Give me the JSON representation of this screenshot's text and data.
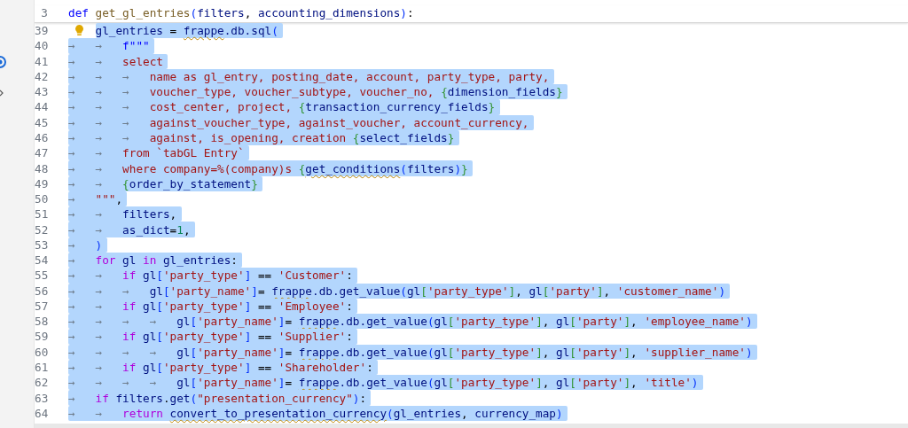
{
  "sticky_line": {
    "number": "3",
    "tokens": [
      {
        "kind": "kw",
        "text": "def "
      },
      {
        "kind": "fn",
        "text": "get_gl_entries"
      },
      {
        "kind": "pa",
        "text": "("
      },
      {
        "kind": "id",
        "text": "filters"
      },
      {
        "kind": "op",
        "text": ", "
      },
      {
        "kind": "id",
        "text": "accounting_dimensions"
      },
      {
        "kind": "pa",
        "text": ")"
      },
      {
        "kind": "op",
        "text": ":"
      }
    ]
  },
  "lines": [
    {
      "number": "39",
      "lightbulb": true,
      "selected": true,
      "tokens": [
        {
          "kind": "id",
          "text": "gl_entries"
        },
        {
          "kind": "op",
          "text": " = "
        },
        {
          "kind": "warn",
          "text": "frappe"
        },
        {
          "kind": "id",
          "text": ".db.sql"
        },
        {
          "kind": "pa",
          "text": "("
        }
      ]
    },
    {
      "number": "40",
      "indent": "→   →",
      "selected": true,
      "tokens": [
        {
          "kind": "kw",
          "text": "f\"\"\""
        }
      ]
    },
    {
      "number": "41",
      "indent": "→   →",
      "selected": true,
      "tokens": [
        {
          "kind": "str",
          "text": "select"
        }
      ]
    },
    {
      "number": "42",
      "indent": "→   →   →",
      "selected": true,
      "tokens": [
        {
          "kind": "str",
          "text": "name as gl_entry, posting_date, account, party_type, party,"
        }
      ]
    },
    {
      "number": "43",
      "indent": "→   →   →",
      "selected": true,
      "tokens": [
        {
          "kind": "str",
          "text": "voucher_type, voucher_subtype, voucher_no, "
        },
        {
          "kind": "br",
          "text": "{"
        },
        {
          "kind": "id",
          "text": "dimension_fields"
        },
        {
          "kind": "br",
          "text": "}"
        }
      ]
    },
    {
      "number": "44",
      "indent": "→   →   →",
      "selected": true,
      "tokens": [
        {
          "kind": "str",
          "text": "cost_center, project, "
        },
        {
          "kind": "br",
          "text": "{"
        },
        {
          "kind": "id",
          "text": "transaction_currency_fields"
        },
        {
          "kind": "br",
          "text": "}"
        }
      ]
    },
    {
      "number": "45",
      "indent": "→   →   →",
      "selected": true,
      "tokens": [
        {
          "kind": "str",
          "text": "against_voucher_type, against_voucher, account_currency,"
        }
      ]
    },
    {
      "number": "46",
      "indent": "→   →   →",
      "selected": true,
      "tokens": [
        {
          "kind": "str",
          "text": "against, is_opening, creation "
        },
        {
          "kind": "br",
          "text": "{"
        },
        {
          "kind": "id",
          "text": "select_fields"
        },
        {
          "kind": "br",
          "text": "}"
        }
      ]
    },
    {
      "number": "47",
      "indent": "→   →",
      "selected": true,
      "tokens": [
        {
          "kind": "str",
          "text": "from `tabGL Entry`"
        }
      ]
    },
    {
      "number": "48",
      "indent": "→   →",
      "selected": true,
      "tokens": [
        {
          "kind": "str",
          "text": "where company=%(company)s "
        },
        {
          "kind": "br",
          "text": "{"
        },
        {
          "kind": "warn",
          "text": "get_conditions"
        },
        {
          "kind": "pa",
          "text": "("
        },
        {
          "kind": "id",
          "text": "filters"
        },
        {
          "kind": "pa",
          "text": ")"
        },
        {
          "kind": "br",
          "text": "}"
        }
      ]
    },
    {
      "number": "49",
      "indent": "→   →",
      "selected": true,
      "tokens": [
        {
          "kind": "br",
          "text": "{"
        },
        {
          "kind": "id",
          "text": "order_by_statement"
        },
        {
          "kind": "br",
          "text": "}"
        }
      ]
    },
    {
      "number": "50",
      "indent": "→",
      "selected": true,
      "tokens": [
        {
          "kind": "str",
          "text": "\"\"\""
        },
        {
          "kind": "op",
          "text": ","
        }
      ]
    },
    {
      "number": "51",
      "indent": "→   →",
      "selected": true,
      "tokens": [
        {
          "kind": "id",
          "text": "filters"
        },
        {
          "kind": "op",
          "text": ","
        }
      ]
    },
    {
      "number": "52",
      "indent": "→   →",
      "selected": true,
      "tokens": [
        {
          "kind": "id",
          "text": "as_dict"
        },
        {
          "kind": "op",
          "text": "="
        },
        {
          "kind": "num",
          "text": "1"
        },
        {
          "kind": "op",
          "text": ","
        }
      ]
    },
    {
      "number": "53",
      "indent": "→",
      "selected": true,
      "tokens": [
        {
          "kind": "pa",
          "text": ")"
        }
      ]
    },
    {
      "number": "54",
      "indent": "→",
      "selected": true,
      "tokens": [
        {
          "kind": "ctl",
          "text": "for "
        },
        {
          "kind": "id",
          "text": "gl "
        },
        {
          "kind": "ctl",
          "text": "in "
        },
        {
          "kind": "id",
          "text": "gl_entries"
        },
        {
          "kind": "op",
          "text": ":"
        }
      ]
    },
    {
      "number": "55",
      "indent": "→   →",
      "selected": true,
      "tokens": [
        {
          "kind": "ctl",
          "text": "if "
        },
        {
          "kind": "id",
          "text": "gl"
        },
        {
          "kind": "pa",
          "text": "["
        },
        {
          "kind": "str",
          "text": "'party_type'"
        },
        {
          "kind": "pa",
          "text": "]"
        },
        {
          "kind": "op",
          "text": " == "
        },
        {
          "kind": "str",
          "text": "'Customer'"
        },
        {
          "kind": "op",
          "text": ":"
        }
      ]
    },
    {
      "number": "56",
      "indent": "→   →   →",
      "selected": true,
      "tokens": [
        {
          "kind": "id",
          "text": "gl"
        },
        {
          "kind": "pa",
          "text": "["
        },
        {
          "kind": "str",
          "text": "'party_name'"
        },
        {
          "kind": "pa",
          "text": "]"
        },
        {
          "kind": "op",
          "text": "= "
        },
        {
          "kind": "warn",
          "text": "frappe"
        },
        {
          "kind": "id",
          "text": ".db.get_value"
        },
        {
          "kind": "pa",
          "text": "("
        },
        {
          "kind": "id",
          "text": "gl"
        },
        {
          "kind": "br",
          "text": "["
        },
        {
          "kind": "str",
          "text": "'party_type'"
        },
        {
          "kind": "br",
          "text": "]"
        },
        {
          "kind": "op",
          "text": ", "
        },
        {
          "kind": "id",
          "text": "gl"
        },
        {
          "kind": "br",
          "text": "["
        },
        {
          "kind": "str",
          "text": "'party'"
        },
        {
          "kind": "br",
          "text": "]"
        },
        {
          "kind": "op",
          "text": ", "
        },
        {
          "kind": "str",
          "text": "'customer_name'"
        },
        {
          "kind": "pa",
          "text": ")"
        }
      ]
    },
    {
      "number": "57",
      "indent": "→   →",
      "selected": true,
      "tokens": [
        {
          "kind": "ctl",
          "text": "if "
        },
        {
          "kind": "id",
          "text": "gl"
        },
        {
          "kind": "pa",
          "text": "["
        },
        {
          "kind": "str",
          "text": "'party_type'"
        },
        {
          "kind": "pa",
          "text": "]"
        },
        {
          "kind": "op",
          "text": " == "
        },
        {
          "kind": "str",
          "text": "'Employee'"
        },
        {
          "kind": "op",
          "text": ":"
        }
      ]
    },
    {
      "number": "58",
      "indent": "→   →   →   →",
      "selected": true,
      "tokens": [
        {
          "kind": "id",
          "text": "gl"
        },
        {
          "kind": "pa",
          "text": "["
        },
        {
          "kind": "str",
          "text": "'party_name'"
        },
        {
          "kind": "pa",
          "text": "]"
        },
        {
          "kind": "op",
          "text": "= "
        },
        {
          "kind": "warn",
          "text": "frappe"
        },
        {
          "kind": "id",
          "text": ".db.get_value"
        },
        {
          "kind": "pa",
          "text": "("
        },
        {
          "kind": "id",
          "text": "gl"
        },
        {
          "kind": "br",
          "text": "["
        },
        {
          "kind": "str",
          "text": "'party_type'"
        },
        {
          "kind": "br",
          "text": "]"
        },
        {
          "kind": "op",
          "text": ", "
        },
        {
          "kind": "id",
          "text": "gl"
        },
        {
          "kind": "br",
          "text": "["
        },
        {
          "kind": "str",
          "text": "'party'"
        },
        {
          "kind": "br",
          "text": "]"
        },
        {
          "kind": "op",
          "text": ", "
        },
        {
          "kind": "str",
          "text": "'employee_name'"
        },
        {
          "kind": "pa",
          "text": ")"
        }
      ]
    },
    {
      "number": "59",
      "indent": "→   →",
      "selected": true,
      "tokens": [
        {
          "kind": "ctl",
          "text": "if "
        },
        {
          "kind": "id",
          "text": "gl"
        },
        {
          "kind": "pa",
          "text": "["
        },
        {
          "kind": "str",
          "text": "'party_type'"
        },
        {
          "kind": "pa",
          "text": "]"
        },
        {
          "kind": "op",
          "text": " == "
        },
        {
          "kind": "str",
          "text": "'Supplier'"
        },
        {
          "kind": "op",
          "text": ":"
        }
      ]
    },
    {
      "number": "60",
      "indent": "→   →   →   →",
      "selected": true,
      "tokens": [
        {
          "kind": "id",
          "text": "gl"
        },
        {
          "kind": "pa",
          "text": "["
        },
        {
          "kind": "str",
          "text": "'party_name'"
        },
        {
          "kind": "pa",
          "text": "]"
        },
        {
          "kind": "op",
          "text": "= "
        },
        {
          "kind": "warn",
          "text": "frappe"
        },
        {
          "kind": "id",
          "text": ".db.get_value"
        },
        {
          "kind": "pa",
          "text": "("
        },
        {
          "kind": "id",
          "text": "gl"
        },
        {
          "kind": "br",
          "text": "["
        },
        {
          "kind": "str",
          "text": "'party_type'"
        },
        {
          "kind": "br",
          "text": "]"
        },
        {
          "kind": "op",
          "text": ", "
        },
        {
          "kind": "id",
          "text": "gl"
        },
        {
          "kind": "br",
          "text": "["
        },
        {
          "kind": "str",
          "text": "'party'"
        },
        {
          "kind": "br",
          "text": "]"
        },
        {
          "kind": "op",
          "text": ", "
        },
        {
          "kind": "str",
          "text": "'supplier_name'"
        },
        {
          "kind": "pa",
          "text": ")"
        }
      ]
    },
    {
      "number": "61",
      "indent": "→   →",
      "selected": true,
      "tokens": [
        {
          "kind": "ctl",
          "text": "if "
        },
        {
          "kind": "id",
          "text": "gl"
        },
        {
          "kind": "pa",
          "text": "["
        },
        {
          "kind": "str",
          "text": "'party_type'"
        },
        {
          "kind": "pa",
          "text": "]"
        },
        {
          "kind": "op",
          "text": " == "
        },
        {
          "kind": "str",
          "text": "'Shareholder'"
        },
        {
          "kind": "op",
          "text": ":"
        }
      ]
    },
    {
      "number": "62",
      "indent": "→   →   →   →",
      "selected": true,
      "tokens": [
        {
          "kind": "id",
          "text": "gl"
        },
        {
          "kind": "pa",
          "text": "["
        },
        {
          "kind": "str",
          "text": "'party_name'"
        },
        {
          "kind": "pa",
          "text": "]"
        },
        {
          "kind": "op",
          "text": "= "
        },
        {
          "kind": "warn",
          "text": "frappe"
        },
        {
          "kind": "id",
          "text": ".db.get_value"
        },
        {
          "kind": "pa",
          "text": "("
        },
        {
          "kind": "id",
          "text": "gl"
        },
        {
          "kind": "br",
          "text": "["
        },
        {
          "kind": "str",
          "text": "'party_type'"
        },
        {
          "kind": "br",
          "text": "]"
        },
        {
          "kind": "op",
          "text": ", "
        },
        {
          "kind": "id",
          "text": "gl"
        },
        {
          "kind": "br",
          "text": "["
        },
        {
          "kind": "str",
          "text": "'party'"
        },
        {
          "kind": "br",
          "text": "]"
        },
        {
          "kind": "op",
          "text": ", "
        },
        {
          "kind": "str",
          "text": "'title'"
        },
        {
          "kind": "pa",
          "text": ")"
        }
      ]
    },
    {
      "number": "63",
      "indent": "→",
      "selected": true,
      "tokens": [
        {
          "kind": "ctl",
          "text": "if "
        },
        {
          "kind": "id",
          "text": "filters"
        },
        {
          "kind": "op",
          "text": "."
        },
        {
          "kind": "id",
          "text": "get"
        },
        {
          "kind": "pa",
          "text": "("
        },
        {
          "kind": "str",
          "text": "\"presentation_currency\""
        },
        {
          "kind": "pa",
          "text": ")"
        },
        {
          "kind": "op",
          "text": ":"
        }
      ]
    },
    {
      "number": "64",
      "indent": "→   →",
      "selected": true,
      "tokens": [
        {
          "kind": "ctl",
          "text": "return "
        },
        {
          "kind": "warn",
          "text": "convert_to_presentation_currency"
        },
        {
          "kind": "pa",
          "text": "("
        },
        {
          "kind": "id",
          "text": "gl_entries"
        },
        {
          "kind": "op",
          "text": ", "
        },
        {
          "kind": "id",
          "text": "currency_map"
        },
        {
          "kind": "pa",
          "text": ")"
        }
      ]
    }
  ]
}
